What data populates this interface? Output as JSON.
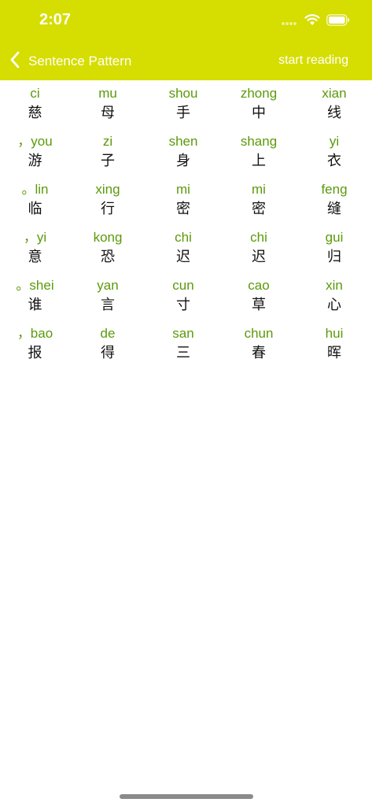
{
  "status_bar": {
    "time": "2:07",
    "icons": [
      "signal-dots-icon",
      "wifi-icon",
      "battery-icon"
    ]
  },
  "nav": {
    "title": "Sentence Pattern",
    "back_icon": "chevron-left-icon",
    "action_label": "start reading"
  },
  "colors": {
    "header_bg": "#d6dd00",
    "pinyin": "#5b9a0a",
    "hanzi": "#111111"
  },
  "rows": [
    [
      {
        "pinyin": "ci",
        "hanzi": "慈"
      },
      {
        "pinyin": "mu",
        "hanzi": "母"
      },
      {
        "pinyin": "shou",
        "hanzi": "手"
      },
      {
        "pinyin": "zhong",
        "hanzi": "中"
      },
      {
        "pinyin": "xian",
        "hanzi": "线"
      }
    ],
    [
      {
        "pinyin": "，you",
        "hanzi": "游"
      },
      {
        "pinyin": "zi",
        "hanzi": "子"
      },
      {
        "pinyin": "shen",
        "hanzi": "身"
      },
      {
        "pinyin": "shang",
        "hanzi": "上"
      },
      {
        "pinyin": "yi",
        "hanzi": "衣"
      }
    ],
    [
      {
        "pinyin": "。lin",
        "hanzi": "临"
      },
      {
        "pinyin": "xing",
        "hanzi": "行"
      },
      {
        "pinyin": "mi",
        "hanzi": "密"
      },
      {
        "pinyin": "mi",
        "hanzi": "密"
      },
      {
        "pinyin": "feng",
        "hanzi": "缝"
      }
    ],
    [
      {
        "pinyin": "，yi",
        "hanzi": "意"
      },
      {
        "pinyin": "kong",
        "hanzi": "恐"
      },
      {
        "pinyin": "chi",
        "hanzi": "迟"
      },
      {
        "pinyin": "chi",
        "hanzi": "迟"
      },
      {
        "pinyin": "gui",
        "hanzi": "归"
      }
    ],
    [
      {
        "pinyin": "。shei",
        "hanzi": "谁"
      },
      {
        "pinyin": "yan",
        "hanzi": "言"
      },
      {
        "pinyin": "cun",
        "hanzi": "寸"
      },
      {
        "pinyin": "cao",
        "hanzi": "草"
      },
      {
        "pinyin": "xin",
        "hanzi": "心"
      }
    ],
    [
      {
        "pinyin": "，bao",
        "hanzi": "报"
      },
      {
        "pinyin": "de",
        "hanzi": "得"
      },
      {
        "pinyin": "san",
        "hanzi": "三"
      },
      {
        "pinyin": "chun",
        "hanzi": "春"
      },
      {
        "pinyin": "hui",
        "hanzi": "晖"
      }
    ]
  ]
}
